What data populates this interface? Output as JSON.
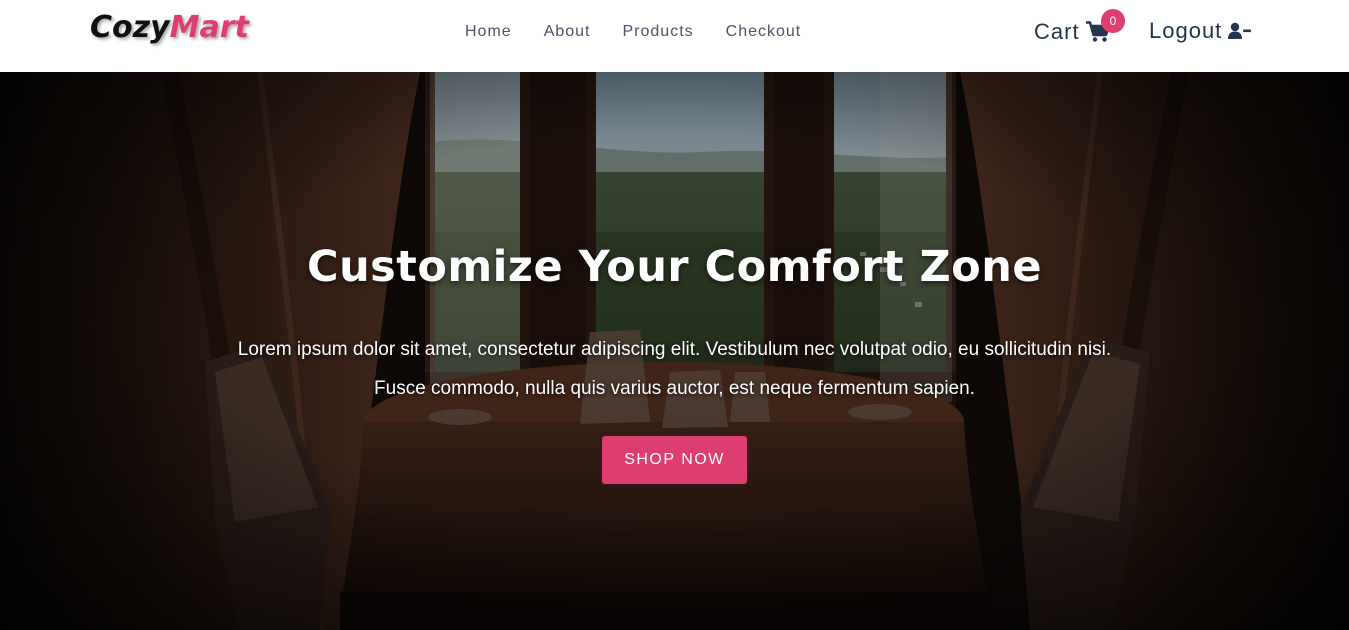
{
  "brand": {
    "part1": "Cozy",
    "part2": "Mart"
  },
  "nav": {
    "items": [
      {
        "label": "Home"
      },
      {
        "label": "About"
      },
      {
        "label": "Products"
      },
      {
        "label": "Checkout"
      }
    ]
  },
  "cart": {
    "label": "Cart",
    "count": "0",
    "icon": "cart-icon"
  },
  "logout": {
    "label": "Logout",
    "icon": "user-minus-icon"
  },
  "hero": {
    "title": "Customize Your Comfort Zone",
    "text": "Lorem ipsum dolor sit amet, consectetur adipiscing elit. Vestibulum nec volutpat odio, eu sollicitudin nisi. Fusce commodo, nulla quis varius auctor, est neque fermentum sapien.",
    "button": "SHOP NOW"
  },
  "colors": {
    "accent": "#dd3e6f",
    "nav_text": "#4a5568",
    "dark_text": "#24364e"
  }
}
